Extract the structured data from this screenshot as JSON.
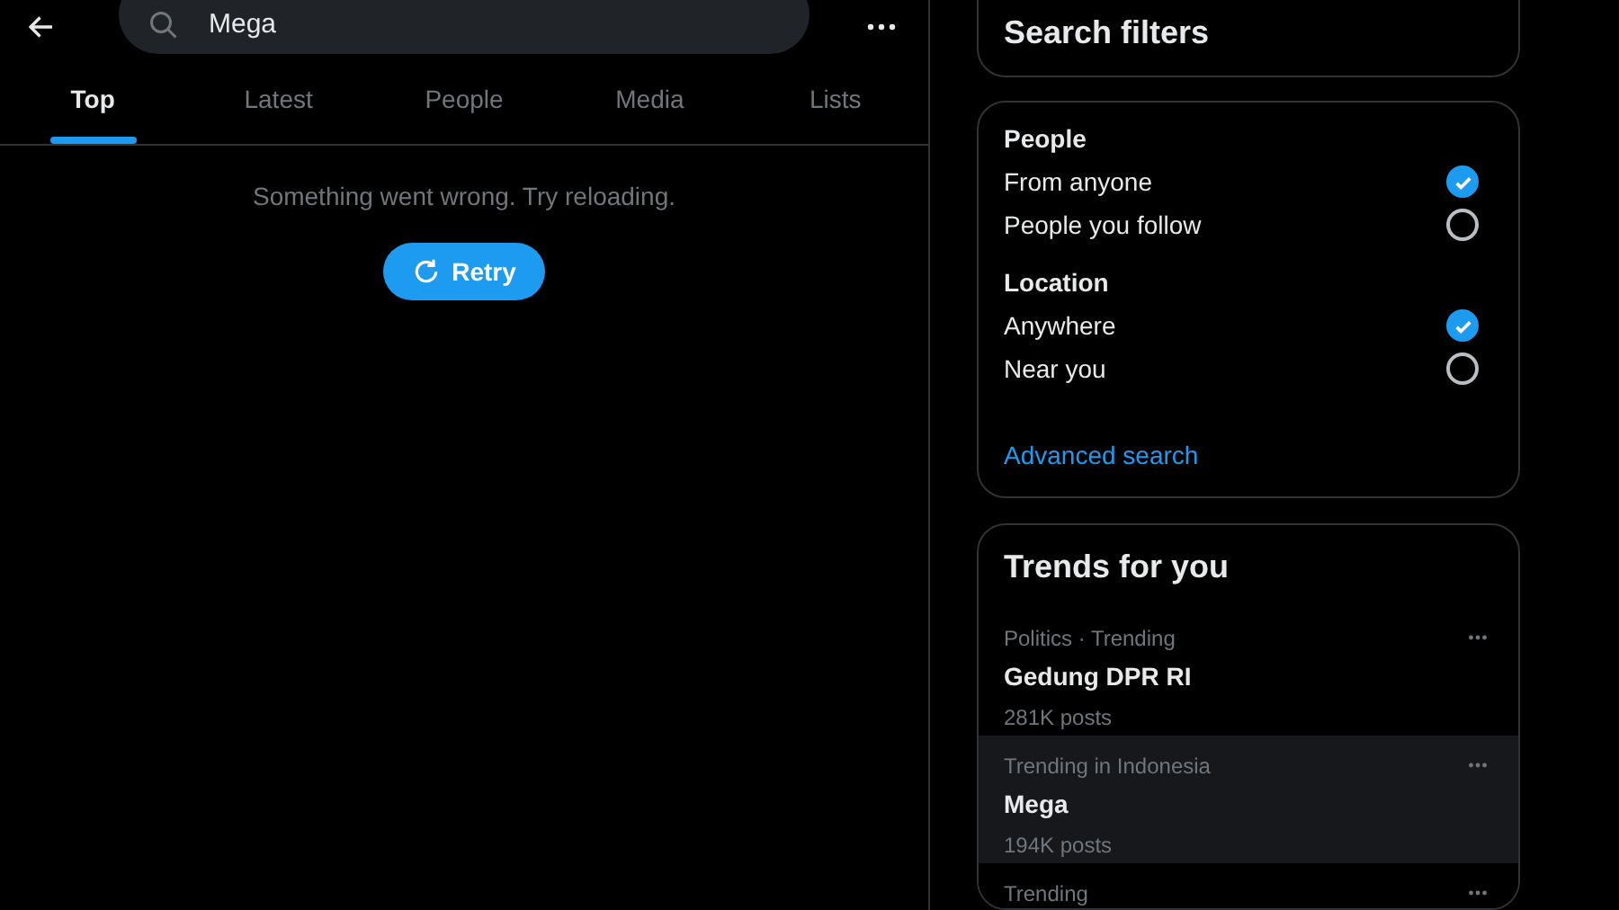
{
  "search": {
    "value": "Mega"
  },
  "tabs": [
    {
      "label": "Top",
      "selected": true
    },
    {
      "label": "Latest",
      "selected": false
    },
    {
      "label": "People",
      "selected": false
    },
    {
      "label": "Media",
      "selected": false
    },
    {
      "label": "Lists",
      "selected": false
    }
  ],
  "error": {
    "message": "Something went wrong. Try reloading.",
    "button": "Retry"
  },
  "search_filters": {
    "title": "Search filters",
    "groups": [
      {
        "heading": "People",
        "options": [
          {
            "label": "From anyone",
            "selected": true
          },
          {
            "label": "People you follow",
            "selected": false
          }
        ]
      },
      {
        "heading": "Location",
        "options": [
          {
            "label": "Anywhere",
            "selected": true
          },
          {
            "label": "Near you",
            "selected": false
          }
        ]
      }
    ],
    "link": "Advanced search"
  },
  "trends": {
    "title": "Trends for you",
    "items": [
      {
        "context": "Politics · Trending",
        "name": "Gedung DPR RI",
        "count": "281K posts",
        "selected": false
      },
      {
        "context": "Trending in Indonesia",
        "name": "Mega",
        "count": "194K posts",
        "selected": true
      },
      {
        "context": "Trending",
        "selected": false
      }
    ]
  }
}
